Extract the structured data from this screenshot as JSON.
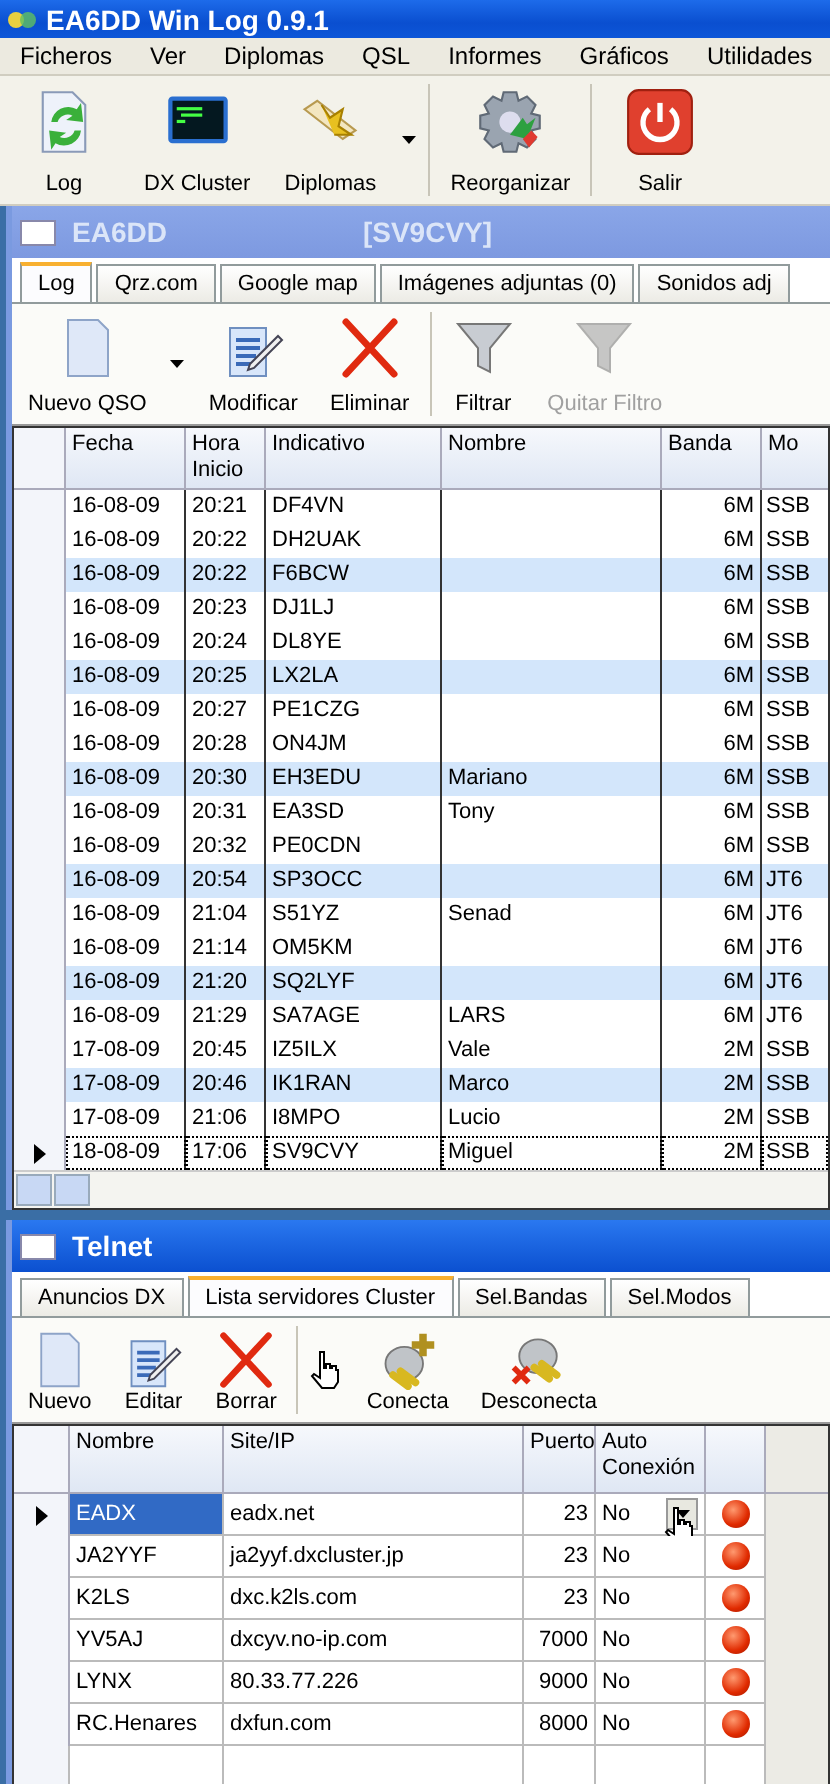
{
  "window": {
    "title": "EA6DD Win Log 0.9.1"
  },
  "menu": [
    {
      "label": "Ficheros"
    },
    {
      "label": "Ver"
    },
    {
      "label": "Diplomas"
    },
    {
      "label": "QSL"
    },
    {
      "label": "Informes"
    },
    {
      "label": "Gráficos"
    },
    {
      "label": "Utilidades"
    }
  ],
  "toolbar": [
    {
      "label": "Log",
      "kind": "log",
      "dropdown": false,
      "separator_before": false
    },
    {
      "label": "DX Cluster",
      "kind": "monitor",
      "dropdown": false,
      "separator_before": false
    },
    {
      "label": "Diplomas",
      "kind": "scroll",
      "dropdown": true,
      "separator_before": false
    },
    {
      "label": "Reorganizar",
      "kind": "gear",
      "dropdown": false,
      "separator_before": true
    },
    {
      "label": "Salir",
      "kind": "power",
      "dropdown": false,
      "separator_before": true
    }
  ],
  "log_window": {
    "title": "EA6DD",
    "callsign": "[SV9CVY]",
    "active": false,
    "tabs": [
      {
        "label": "Log",
        "selected": true
      },
      {
        "label": "Qrz.com",
        "selected": false
      },
      {
        "label": "Google map",
        "selected": false
      },
      {
        "label": "Imágenes adjuntas (0)",
        "selected": false
      },
      {
        "label": "Sonidos adj",
        "selected": false
      }
    ],
    "toolbar": [
      {
        "label": "Nuevo QSO",
        "kind": "new",
        "dropdown": true,
        "disabled": false,
        "separator_before": false
      },
      {
        "label": "Modificar",
        "kind": "edit",
        "dropdown": false,
        "disabled": false,
        "separator_before": false
      },
      {
        "label": "Eliminar",
        "kind": "delete",
        "dropdown": false,
        "disabled": false,
        "separator_before": false
      },
      {
        "label": "Filtrar",
        "kind": "filter",
        "dropdown": false,
        "disabled": false,
        "separator_before": true
      },
      {
        "label": "Quitar Filtro",
        "kind": "unfilter",
        "dropdown": false,
        "disabled": true,
        "separator_before": false
      }
    ],
    "table": {
      "columns": [
        "Fecha",
        "Hora Inicio",
        "Indicativo",
        "Nombre",
        "Banda",
        "Mo"
      ],
      "rows": [
        {
          "cells": [
            "16-08-09",
            "20:21",
            "DF4VN",
            "",
            "6M",
            "SSB"
          ],
          "selected": false
        },
        {
          "cells": [
            "16-08-09",
            "20:22",
            "DH2UAK",
            "",
            "6M",
            "SSB"
          ],
          "selected": false
        },
        {
          "cells": [
            "16-08-09",
            "20:22",
            "F6BCW",
            "",
            "6M",
            "SSB"
          ],
          "selected": false
        },
        {
          "cells": [
            "16-08-09",
            "20:23",
            "DJ1LJ",
            "",
            "6M",
            "SSB"
          ],
          "selected": false
        },
        {
          "cells": [
            "16-08-09",
            "20:24",
            "DL8YE",
            "",
            "6M",
            "SSB"
          ],
          "selected": false
        },
        {
          "cells": [
            "16-08-09",
            "20:25",
            "LX2LA",
            "",
            "6M",
            "SSB"
          ],
          "selected": false
        },
        {
          "cells": [
            "16-08-09",
            "20:27",
            "PE1CZG",
            "",
            "6M",
            "SSB"
          ],
          "selected": false
        },
        {
          "cells": [
            "16-08-09",
            "20:28",
            "ON4JM",
            "",
            "6M",
            "SSB"
          ],
          "selected": false
        },
        {
          "cells": [
            "16-08-09",
            "20:30",
            "EH3EDU",
            "Mariano",
            "6M",
            "SSB"
          ],
          "selected": false
        },
        {
          "cells": [
            "16-08-09",
            "20:31",
            "EA3SD",
            "Tony",
            "6M",
            "SSB"
          ],
          "selected": false
        },
        {
          "cells": [
            "16-08-09",
            "20:32",
            "PE0CDN",
            "",
            "6M",
            "SSB"
          ],
          "selected": false
        },
        {
          "cells": [
            "16-08-09",
            "20:54",
            "SP3OCC",
            "",
            "6M",
            "JT6"
          ],
          "selected": false
        },
        {
          "cells": [
            "16-08-09",
            "21:04",
            "S51YZ",
            "Senad",
            "6M",
            "JT6"
          ],
          "selected": false
        },
        {
          "cells": [
            "16-08-09",
            "21:14",
            "OM5KM",
            "",
            "6M",
            "JT6"
          ],
          "selected": false
        },
        {
          "cells": [
            "16-08-09",
            "21:20",
            "SQ2LYF",
            "",
            "6M",
            "JT6"
          ],
          "selected": false
        },
        {
          "cells": [
            "16-08-09",
            "21:29",
            "SA7AGE",
            "LARS",
            "6M",
            "JT6"
          ],
          "selected": false
        },
        {
          "cells": [
            "17-08-09",
            "20:45",
            "IZ5ILX",
            "Vale",
            "2M",
            "SSB"
          ],
          "selected": false
        },
        {
          "cells": [
            "17-08-09",
            "20:46",
            "IK1RAN",
            "Marco",
            "2M",
            "SSB"
          ],
          "selected": false
        },
        {
          "cells": [
            "17-08-09",
            "21:06",
            "I8MPO",
            "Lucio",
            "2M",
            "SSB"
          ],
          "selected": false
        },
        {
          "cells": [
            "18-08-09",
            "17:06",
            "SV9CVY",
            "Miguel",
            "2M",
            "SSB"
          ],
          "selected": true
        }
      ]
    }
  },
  "telnet_window": {
    "title": "Telnet",
    "active": true,
    "tabs": [
      {
        "label": "Anuncios DX",
        "selected": false
      },
      {
        "label": "Lista servidores Cluster",
        "selected": true
      },
      {
        "label": "Sel.Bandas",
        "selected": false
      },
      {
        "label": "Sel.Modos",
        "selected": false
      }
    ],
    "toolbar": [
      {
        "label": "Nuevo",
        "kind": "new",
        "dropdown": false,
        "disabled": false,
        "separator_before": false
      },
      {
        "label": "Editar",
        "kind": "edit",
        "dropdown": false,
        "disabled": false,
        "separator_before": false
      },
      {
        "label": "Borrar",
        "kind": "delete",
        "dropdown": false,
        "disabled": false,
        "separator_before": false
      },
      {
        "label": "Conecta",
        "kind": "connect",
        "dropdown": false,
        "disabled": false,
        "separator_before": true
      },
      {
        "label": "Desconecta",
        "kind": "disconnect",
        "dropdown": false,
        "disabled": false,
        "separator_before": false
      }
    ],
    "table": {
      "columns": [
        "Nombre",
        "Site/IP",
        "Puerto",
        "Auto Conexión"
      ],
      "rows": [
        {
          "cells": [
            "EADX",
            "eadx.net",
            "23",
            "No"
          ],
          "selected": true
        },
        {
          "cells": [
            "JA2YYF",
            "ja2yyf.dxcluster.jp",
            "23",
            "No"
          ],
          "selected": false
        },
        {
          "cells": [
            "K2LS",
            "dxc.k2ls.com",
            "23",
            "No"
          ],
          "selected": false
        },
        {
          "cells": [
            "YV5AJ",
            "dxcyv.no-ip.com",
            "7000",
            "No"
          ],
          "selected": false
        },
        {
          "cells": [
            "LYNX",
            "80.33.77.226",
            "9000",
            "No"
          ],
          "selected": false
        },
        {
          "cells": [
            "RC.Henares",
            "dxfun.com",
            "8000",
            "No"
          ],
          "selected": false
        }
      ]
    }
  }
}
